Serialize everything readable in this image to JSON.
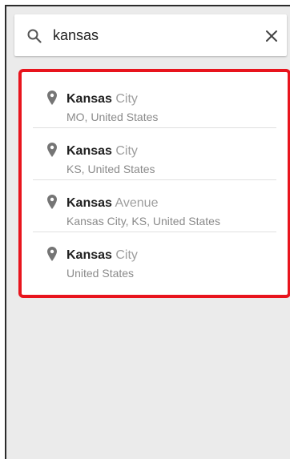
{
  "search": {
    "query": "kansas",
    "icon": "search-icon",
    "clear_icon": "close-icon"
  },
  "results": [
    {
      "match": "Kansas",
      "rest": " City",
      "subtitle": "MO, United States"
    },
    {
      "match": "Kansas",
      "rest": " City",
      "subtitle": "KS, United States"
    },
    {
      "match": "Kansas",
      "rest": " Avenue",
      "subtitle": "Kansas City, KS, United States"
    },
    {
      "match": "Kansas",
      "rest": " City",
      "subtitle": "United States"
    }
  ],
  "colors": {
    "highlight_border": "#e8141d",
    "background": "#ebebeb",
    "text_primary": "#212121",
    "text_secondary": "#9e9e9e"
  }
}
